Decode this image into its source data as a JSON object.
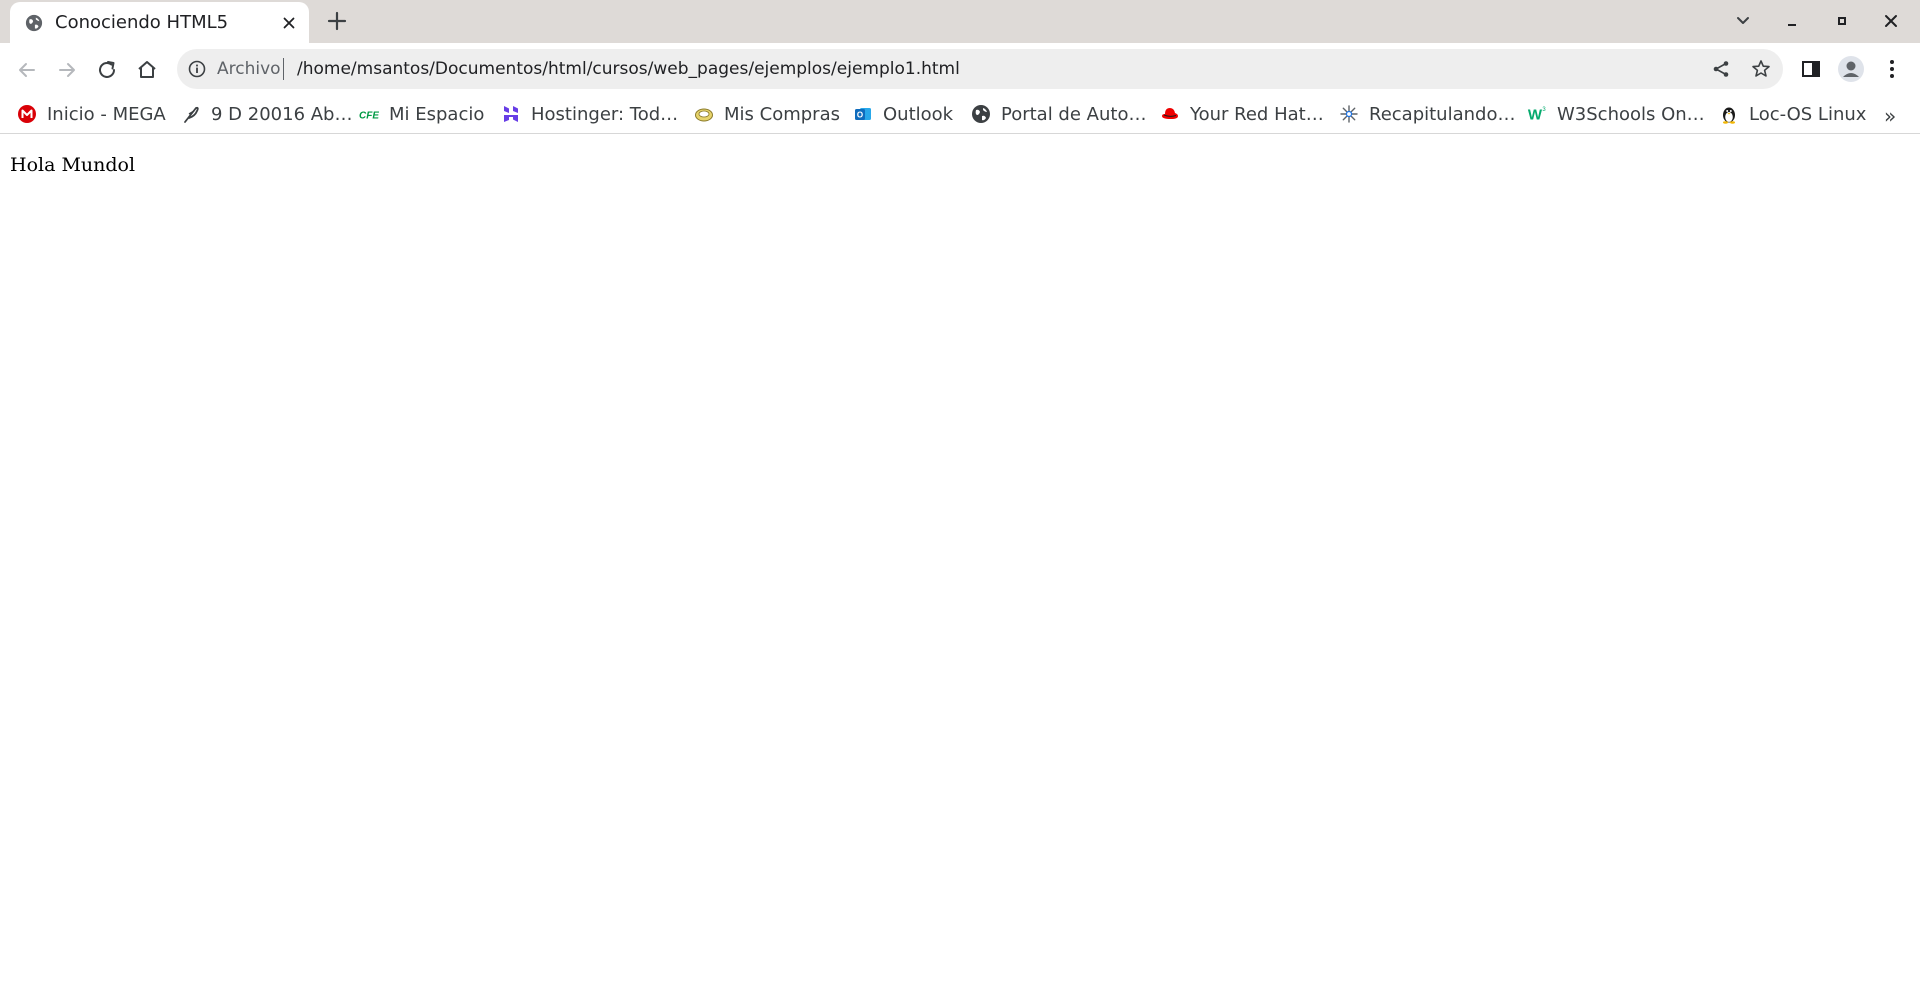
{
  "tab": {
    "title": "Conociendo HTML5",
    "favicon": "globe-icon"
  },
  "toolbar": {
    "omnibox": {
      "scheme_chip": "Archivo",
      "url": "/home/msantos/Documentos/html/cursos/web_pages/ejemplos/ejemplo1.html"
    }
  },
  "bookmarks": [
    {
      "label": "Inicio - MEGA",
      "icon": "mega-icon"
    },
    {
      "label": "9 D 20016 Ab…",
      "icon": "quill-icon"
    },
    {
      "label": "Mi Espacio",
      "icon": "cfe-icon",
      "icon_text": "CFE"
    },
    {
      "label": "Hostinger: Tod…",
      "icon": "hostinger-icon"
    },
    {
      "label": "Mis Compras",
      "icon": "compras-icon"
    },
    {
      "label": "Outlook",
      "icon": "outlook-icon",
      "icon_text": "O"
    },
    {
      "label": "Portal de Auto…",
      "icon": "globe-icon"
    },
    {
      "label": "Your Red Hat…",
      "icon": "redhat-icon"
    },
    {
      "label": "Recapitulando…",
      "icon": "spark-icon"
    },
    {
      "label": "W3Schools On…",
      "icon": "w3schools-icon",
      "icon_text": "W"
    },
    {
      "label": "Loc-OS Linux",
      "icon": "penguin-icon"
    }
  ],
  "bookmarks_overflow": "»",
  "page": {
    "text": "Hola Mundol"
  },
  "colors": {
    "tabstrip_bg": "#dedad7",
    "omnibox_bg": "#eeeeee",
    "mega_red": "#d90007",
    "hostinger_purple": "#673de6",
    "cfe_green": "#009a44",
    "outlook_blue": "#0f6cbd",
    "redhat_red": "#ee0000",
    "w3_green": "#04aa6d"
  }
}
